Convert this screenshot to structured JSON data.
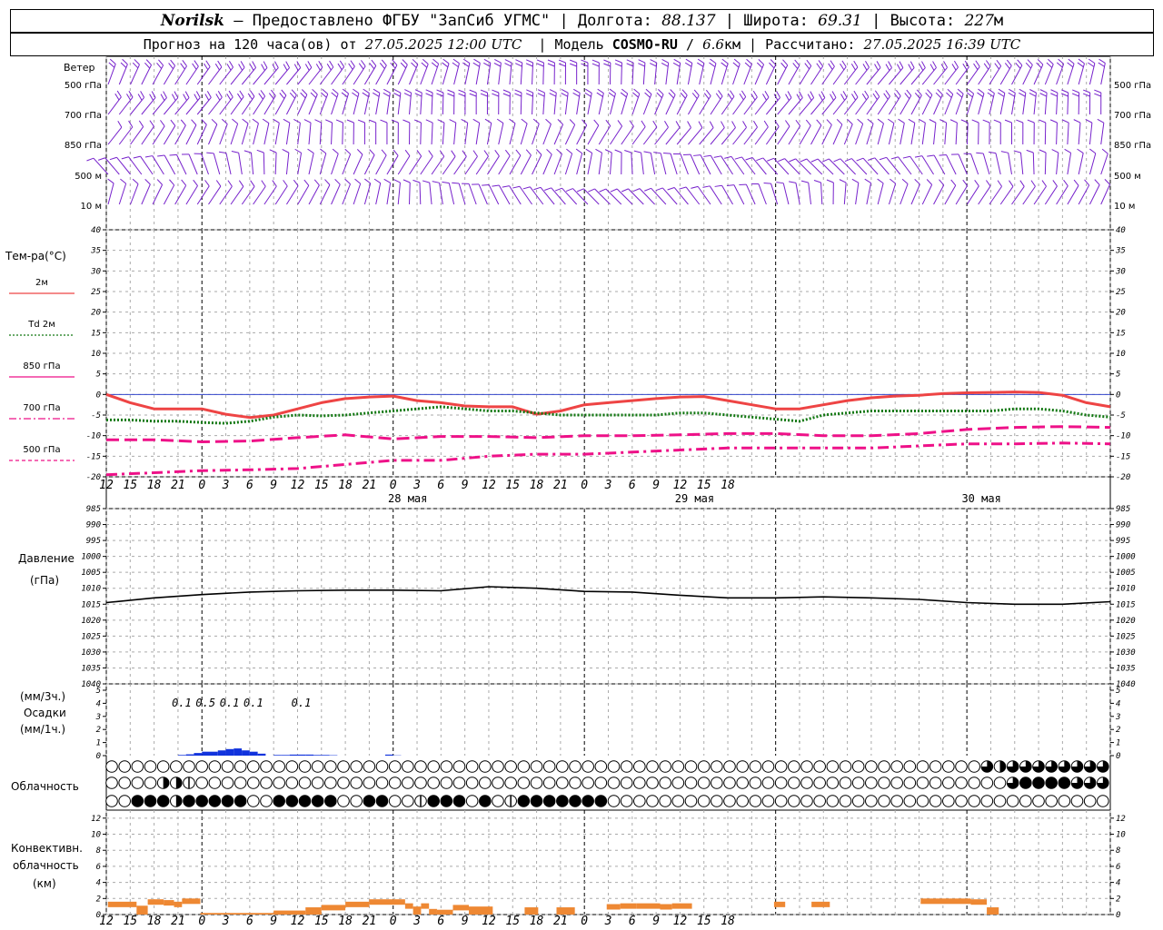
{
  "header": {
    "station": "Norilsk",
    "dash": "–",
    "provider": "Предоставлено ФГБУ \"ЗапСиб УГМС\"",
    "lon_label": "Долгота:",
    "lon": "88.137",
    "lat_label": "Широта:",
    "lat": "69.31",
    "alt_label": "Высота:",
    "alt": "227",
    "alt_unit": "м",
    "forecast_label": "Прогноз на 120 часа(ов) от",
    "forecast_time": "27.05.2025 12:00 UTC",
    "model_label": "Модель",
    "model": "COSMO-RU",
    "resolution": "6.6",
    "res_unit": "км",
    "computed_label": "Рассчитано:",
    "computed_time": "27.05.2025 16:39 UTC"
  },
  "wind_panel": {
    "title": "Ветер",
    "levels": [
      "500 гПа",
      "700 гПа",
      "850 гПа",
      "500 м",
      "10 м"
    ]
  },
  "temp_panel": {
    "title": "Тем-ра(°C)",
    "legend": [
      "2м",
      "Td  2м",
      "850 гПа",
      "700 гПа",
      "500 гПа"
    ]
  },
  "pressure_panel": {
    "title": "Давление",
    "unit": "(гПа)"
  },
  "precip_panel": {
    "unit1": "(мм/3ч.)",
    "title": "Осадки",
    "unit2": "(мм/1ч.)"
  },
  "cloud_panel": {
    "title": "Облачность"
  },
  "conv_panel": {
    "title": "Конвективн.",
    "title2": "облачность",
    "unit": "(км)"
  },
  "colors": {
    "t2m": "#ee4444",
    "td2m": "#117711",
    "level": "#ee1188",
    "wind": "#7722cc",
    "precip": "#1133dd",
    "conv": "#ee8833",
    "zero": "#3344cc"
  },
  "chart_data": {
    "type": "line",
    "x_hours_from_start": [
      0,
      3,
      6,
      9,
      12,
      15,
      18,
      21,
      24,
      27,
      30,
      33,
      36,
      39,
      42,
      45,
      48,
      51,
      54,
      57,
      60,
      63,
      66,
      69,
      72,
      75,
      78,
      81,
      84,
      87,
      90,
      93,
      96,
      99,
      102,
      105,
      108,
      111,
      114,
      117,
      120,
      123,
      126
    ],
    "x_tick_labels": [
      "12",
      "15",
      "18",
      "21",
      "0",
      "3",
      "6",
      "9",
      "12",
      "15",
      "18",
      "21",
      "0",
      "3",
      "6",
      "9",
      "12",
      "15",
      "18",
      "21",
      "0",
      "3",
      "6",
      "9",
      "12",
      "15",
      "18"
    ],
    "day_labels": [
      "28 мая",
      "29 мая",
      "30 мая"
    ],
    "temperature": {
      "ylim": [
        -20,
        40
      ],
      "yticks": [
        -20,
        -15,
        -10,
        -5,
        0,
        5,
        10,
        15,
        20,
        25,
        30,
        35,
        40
      ],
      "series": [
        {
          "name": "2м",
          "color": "#ee4444",
          "style": "solid",
          "x": [
            0,
            3,
            6,
            9,
            12,
            15,
            18,
            21,
            24,
            27,
            30,
            33,
            36,
            39,
            42,
            45,
            48,
            51,
            54,
            57,
            60,
            63,
            66,
            69,
            72,
            75,
            78,
            81,
            84,
            87,
            90,
            93,
            96,
            99,
            102,
            105,
            108,
            111,
            114,
            117,
            120,
            123,
            126
          ],
          "values": [
            0,
            -2,
            -3.5,
            -3.5,
            -3.5,
            -4.8,
            -5.6,
            -5,
            -3.5,
            -2,
            -1,
            -0.6,
            -0.4,
            -1.5,
            -2,
            -2.8,
            -3,
            -3,
            -4.8,
            -4,
            -2.5,
            -2,
            -1.5,
            -1,
            -0.6,
            -0.5,
            -1.5,
            -2.5,
            -3.5,
            -3.5,
            -2.5,
            -1.5,
            -0.8,
            -0.4,
            -0.2,
            0.2,
            0.4,
            0.5,
            0.6,
            0.5,
            -0.2,
            -2,
            -3
          ]
        },
        {
          "name": "Td  2м",
          "color": "#117711",
          "style": "dotted",
          "x": [
            0,
            3,
            6,
            9,
            12,
            15,
            18,
            21,
            24,
            27,
            30,
            33,
            36,
            39,
            42,
            45,
            48,
            51,
            54,
            57,
            60,
            63,
            66,
            69,
            72,
            75,
            78,
            81,
            84,
            87,
            90,
            93,
            96,
            99,
            102,
            105,
            108,
            111,
            114,
            117,
            120,
            123,
            126
          ],
          "values": [
            -6.2,
            -6.2,
            -6.5,
            -6.5,
            -6.8,
            -7,
            -6.5,
            -5.5,
            -5,
            -5.2,
            -5,
            -4.5,
            -4,
            -3.5,
            -3,
            -3.5,
            -4,
            -4,
            -4.5,
            -5,
            -5,
            -5,
            -5,
            -5,
            -4.5,
            -4.5,
            -5,
            -5.5,
            -6,
            -6.5,
            -5,
            -4.5,
            -4,
            -4,
            -4,
            -4,
            -4,
            -4,
            -3.5,
            -3.5,
            -4,
            -5,
            -5.5
          ]
        },
        {
          "name": "850 гПа",
          "color": "#ee1188",
          "style": "dashed",
          "x": [
            0,
            6,
            12,
            18,
            24,
            30,
            36,
            42,
            48,
            54,
            60,
            66,
            72,
            78,
            84,
            90,
            96,
            102,
            108,
            114,
            120,
            126
          ],
          "values": [
            -11,
            -11,
            -11.5,
            -11.3,
            -10.5,
            -9.8,
            -10.8,
            -10.2,
            -10.2,
            -10.5,
            -10,
            -10,
            -9.8,
            -9.5,
            -9.5,
            -10,
            -10,
            -9.5,
            -8.5,
            -8,
            -7.8,
            -8
          ]
        },
        {
          "name": "700 гПа",
          "color": "#ee1188",
          "style": "dashdot",
          "x": [
            0,
            6,
            12,
            18,
            24,
            30,
            36,
            42,
            48,
            54,
            60,
            66,
            72,
            78,
            84,
            90,
            96,
            102,
            108,
            114,
            120,
            126
          ],
          "values": [
            -19.5,
            -19,
            -18.5,
            -18.3,
            -18,
            -17,
            -16,
            -16,
            -15,
            -14.5,
            -14.5,
            -14,
            -13.5,
            -13,
            -13,
            -13,
            -13,
            -12.5,
            -12,
            -12,
            -11.8,
            -12
          ]
        }
      ]
    },
    "pressure": {
      "ylim": [
        985,
        1040
      ],
      "yticks": [
        985,
        990,
        995,
        1000,
        1005,
        1010,
        1015,
        1020,
        1025,
        1030,
        1035,
        1040
      ],
      "x": [
        0,
        6,
        12,
        18,
        24,
        30,
        36,
        42,
        48,
        54,
        60,
        66,
        72,
        78,
        84,
        90,
        96,
        102,
        108,
        114,
        120,
        126
      ],
      "values": [
        1010.5,
        1012,
        1013,
        1013.8,
        1014.2,
        1014.4,
        1014.4,
        1014.2,
        1015.5,
        1015,
        1014,
        1013.8,
        1012.8,
        1012,
        1012,
        1012.3,
        1012,
        1011.5,
        1010.5,
        1010,
        1010,
        1010.8
      ]
    },
    "precip": {
      "ylim": [
        0,
        5
      ],
      "yticks": [
        0,
        1,
        2,
        3,
        4,
        5
      ],
      "labels": [
        {
          "x": 9,
          "text": "0.1"
        },
        {
          "x": 12,
          "text": "0.5"
        },
        {
          "x": 15,
          "text": "0.1"
        },
        {
          "x": 18,
          "text": "0.1"
        },
        {
          "x": 24,
          "text": "0.1"
        }
      ],
      "bars_1h_x": [
        34,
        35,
        36,
        37,
        38,
        39,
        40,
        41,
        42,
        43,
        44,
        45,
        46,
        47,
        48,
        49,
        50,
        51,
        52,
        53,
        54,
        55,
        56,
        57,
        58,
        59,
        60,
        61,
        62,
        63,
        64,
        65,
        66,
        67,
        68,
        69,
        70,
        71,
        72,
        73,
        74,
        75,
        76,
        77,
        78,
        79,
        80,
        81,
        82,
        83,
        84,
        85,
        86,
        87,
        88,
        89,
        90,
        91,
        92,
        93,
        94,
        95,
        96,
        97,
        98,
        99,
        100,
        101,
        102,
        103,
        104,
        105,
        106,
        107,
        108,
        109,
        110,
        111,
        112,
        113,
        114,
        115,
        116,
        117,
        118,
        119,
        120,
        121,
        122,
        123,
        124,
        125,
        126
      ],
      "bars_1h": [
        0.05,
        0.1,
        0.2,
        0.3,
        0.3,
        0.4,
        0.5,
        0.55,
        0.4,
        0.3,
        0.15,
        0,
        0.05,
        0.05,
        0.08,
        0.08,
        0.08,
        0.05,
        0.05,
        0.03,
        0,
        0,
        0,
        0,
        0,
        0,
        0.08,
        0.02,
        0,
        0,
        0,
        0,
        0,
        0,
        0,
        0,
        0,
        0,
        0,
        0,
        0,
        0,
        0,
        0,
        0,
        0,
        0,
        0,
        0,
        0,
        0,
        0,
        0,
        0,
        0,
        0,
        0,
        0,
        0,
        0,
        0,
        0,
        0,
        0,
        0,
        0,
        0,
        0,
        0,
        0,
        0,
        0,
        0,
        0,
        0,
        0,
        0,
        0,
        0,
        0,
        0,
        0,
        0,
        0,
        0,
        0,
        0,
        0,
        0,
        0,
        0,
        0,
        0
      ]
    },
    "clouds": {
      "rows": 3,
      "note_levels": "0=clear, 1=quarter, 2=half, 3=three-quarter, 4=overcast",
      "high": [
        0,
        0,
        0,
        0,
        0,
        0,
        0,
        0,
        0,
        0,
        0,
        0,
        0,
        0,
        0,
        0,
        0,
        0,
        0,
        0,
        0,
        0,
        0,
        0,
        0,
        0,
        0,
        0,
        0,
        0,
        0,
        0,
        0,
        0,
        0,
        0,
        0,
        0,
        0,
        0,
        0,
        0,
        0,
        0,
        0,
        0,
        0,
        0,
        0,
        0,
        0,
        0,
        0,
        0,
        0,
        0,
        0,
        0,
        0,
        0,
        0,
        0,
        0,
        0,
        0,
        0,
        0,
        0,
        0,
        0,
        0,
        0,
        0,
        0,
        0,
        0,
        0,
        0,
        0,
        0,
        0,
        0,
        0,
        0,
        0,
        0,
        0,
        0,
        0,
        0,
        0,
        0,
        0,
        0,
        0,
        0,
        0,
        0,
        0,
        0,
        0,
        0,
        0,
        0,
        0,
        0,
        0,
        0,
        0,
        0,
        0,
        0,
        0,
        0,
        0,
        0,
        0,
        0,
        0,
        3,
        2,
        3,
        3,
        3,
        3,
        3,
        3,
        3,
        3,
        3,
        3,
        3,
        3,
        3,
        3,
        3
      ],
      "mid": [
        0,
        0,
        0,
        0,
        0,
        0,
        1,
        2,
        0,
        2,
        1,
        1,
        0,
        0,
        0,
        0,
        0,
        0,
        0,
        0,
        0,
        0,
        0,
        0,
        0,
        0,
        0,
        0,
        0,
        0,
        0,
        0,
        0,
        0,
        0,
        0,
        0,
        0,
        0,
        0,
        0,
        0,
        0,
        0,
        0,
        0,
        0,
        0,
        0,
        0,
        0,
        0,
        0,
        0,
        0,
        0,
        0,
        0,
        0,
        0,
        0,
        0,
        0,
        0,
        0,
        0,
        0,
        0,
        0,
        0,
        0,
        0,
        0,
        0,
        0,
        0,
        0,
        0,
        0,
        0,
        0,
        0,
        0,
        0,
        0,
        0,
        0,
        0,
        0,
        0,
        0,
        0,
        0,
        0,
        0,
        0,
        0,
        0,
        0,
        0,
        0,
        0,
        0,
        0,
        0,
        0,
        0,
        0,
        0,
        0,
        0,
        0,
        0,
        0,
        0,
        0,
        0,
        0,
        0,
        0,
        0,
        0,
        0,
        3,
        3,
        4,
        4,
        4,
        4,
        4,
        4,
        3,
        3,
        3,
        3,
        3,
        3
      ],
      "low": [
        0,
        0,
        0,
        0,
        4,
        4,
        4,
        4,
        1,
        2,
        4,
        4,
        4,
        4,
        4,
        4,
        4,
        4,
        4,
        4,
        0,
        0,
        4,
        4,
        4,
        4,
        4,
        4,
        4,
        4,
        4,
        4,
        0,
        0,
        0,
        4,
        4,
        4,
        4,
        0,
        1,
        0,
        0,
        1,
        4,
        4,
        4,
        4,
        4,
        1,
        0,
        4,
        4,
        0,
        0,
        1,
        4,
        4,
        4,
        4,
        4,
        4,
        4,
        4,
        4,
        4,
        4,
        4,
        4,
        0,
        0,
        0,
        0,
        0,
        0,
        0,
        0,
        0,
        0,
        0,
        0,
        0,
        0,
        0,
        0,
        0,
        0,
        0,
        0,
        0,
        0,
        0,
        0,
        0,
        0,
        0,
        0,
        0,
        0,
        0,
        0,
        0,
        0,
        0,
        0,
        0,
        0,
        0,
        0,
        0,
        0,
        0,
        0,
        0,
        0,
        0,
        0,
        0,
        0,
        0,
        0,
        0,
        0,
        0,
        0,
        0,
        0,
        0,
        0,
        0,
        0,
        0,
        0,
        0,
        0,
        0,
        0,
        0,
        0
      ]
    },
    "convective": {
      "ylim": [
        0,
        13
      ],
      "yticks": [
        0,
        2,
        4,
        6,
        8,
        10,
        12
      ],
      "segments": [
        {
          "x0": 0.2,
          "x1": 3.8,
          "top": 1.6
        },
        {
          "x0": 3.8,
          "x1": 5.2,
          "top": 1.1
        },
        {
          "x0": 5.2,
          "x1": 7.2,
          "top": 1.9
        },
        {
          "x0": 7.2,
          "x1": 8.5,
          "top": 1.8
        },
        {
          "x0": 8.5,
          "x1": 9.5,
          "top": 1.6
        },
        {
          "x0": 9.5,
          "x1": 11.8,
          "top": 2.0
        },
        {
          "x0": 11.8,
          "x1": 21,
          "top": 0.2
        },
        {
          "x0": 21,
          "x1": 25,
          "top": 0.5
        },
        {
          "x0": 25,
          "x1": 27,
          "top": 0.9
        },
        {
          "x0": 27,
          "x1": 30,
          "top": 1.2
        },
        {
          "x0": 30,
          "x1": 33,
          "top": 1.6
        },
        {
          "x0": 33,
          "x1": 37.5,
          "top": 1.9
        },
        {
          "x0": 37.5,
          "x1": 38.5,
          "top": 1.4
        },
        {
          "x0": 38.5,
          "x1": 39.5,
          "top": 1.0
        },
        {
          "x0": 39.5,
          "x1": 40.5,
          "top": 1.4
        },
        {
          "x0": 40.5,
          "x1": 41.5,
          "top": 0.7
        },
        {
          "x0": 41.5,
          "x1": 43.5,
          "top": 0.6
        },
        {
          "x0": 43.5,
          "x1": 45.5,
          "top": 1.2
        },
        {
          "x0": 45.5,
          "x1": 48.5,
          "top": 1.0
        },
        {
          "x0": 52.5,
          "x1": 54.2,
          "top": 0.9
        },
        {
          "x0": 56.5,
          "x1": 58.8,
          "top": 0.9
        },
        {
          "x0": 62.8,
          "x1": 64.5,
          "top": 1.3
        },
        {
          "x0": 64.5,
          "x1": 66.5,
          "top": 1.4
        },
        {
          "x0": 66.5,
          "x1": 69.5,
          "top": 1.4
        },
        {
          "x0": 69.5,
          "x1": 71,
          "top": 1.3
        },
        {
          "x0": 71,
          "x1": 73.5,
          "top": 1.4
        },
        {
          "x0": 83.8,
          "x1": 85.2,
          "top": 1.6
        },
        {
          "x0": 88.5,
          "x1": 90.8,
          "top": 1.6
        },
        {
          "x0": 102.2,
          "x1": 108.5,
          "top": 2.0
        },
        {
          "x0": 108.5,
          "x1": 110.5,
          "top": 1.9
        },
        {
          "x0": 110.5,
          "x1": 112,
          "top": 0.9
        }
      ]
    }
  }
}
